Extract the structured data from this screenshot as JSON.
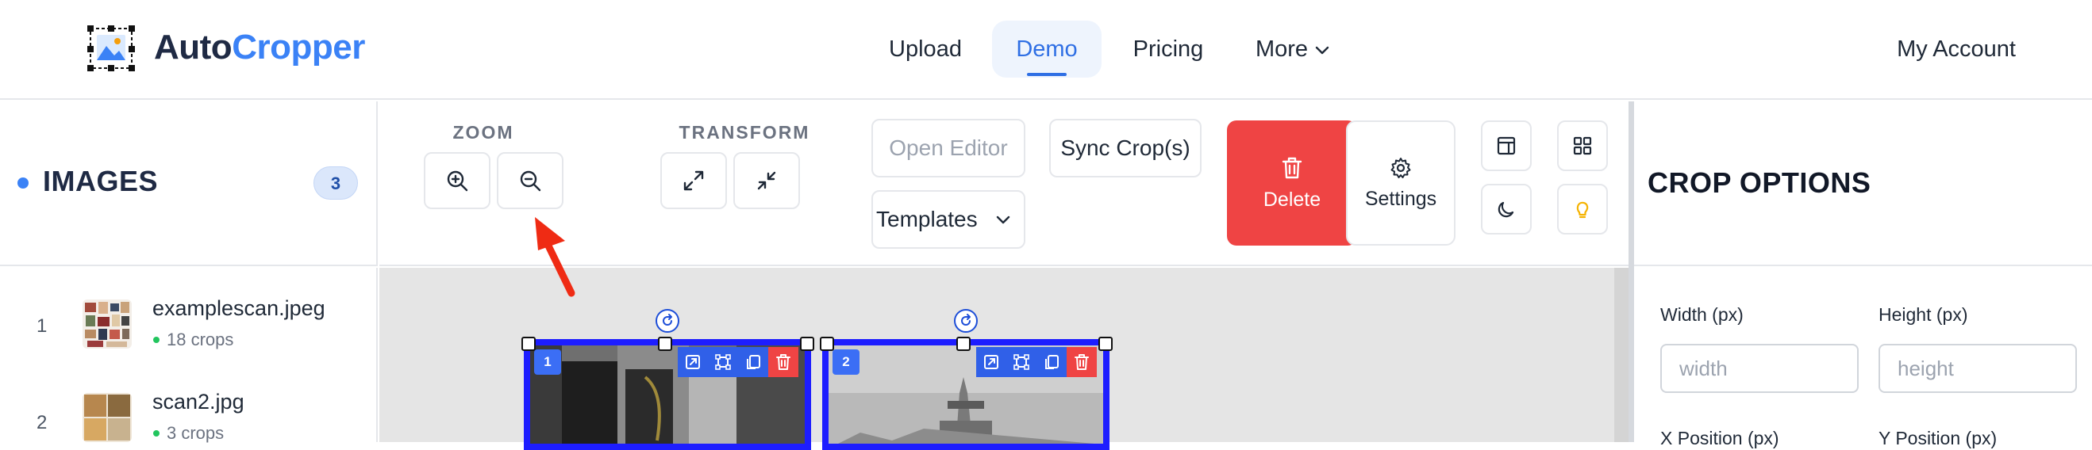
{
  "header": {
    "logo": {
      "part1": "Auto",
      "part2": "Cropper",
      "icon": "image-crop-icon"
    },
    "nav": [
      {
        "label": "Upload"
      },
      {
        "label": "Demo",
        "active": true
      },
      {
        "label": "Pricing"
      },
      {
        "label": "More",
        "icon": "chevron-down-icon"
      }
    ],
    "account_label": "My Account"
  },
  "sidebar": {
    "title": "IMAGES",
    "count": "3",
    "items": [
      {
        "index": "1",
        "name": "examplescan.jpeg",
        "crops": "18 crops"
      },
      {
        "index": "2",
        "name": "scan2.jpg",
        "crops": "3 crops"
      }
    ]
  },
  "toolbar": {
    "zoom_label": "ZOOM",
    "transform_label": "TRANSFORM",
    "open_editor_label": "Open Editor",
    "sync_crops_label": "Sync Crop(s)",
    "templates_label": "Templates",
    "delete_label": "Delete",
    "settings_label": "Settings"
  },
  "crop_options": {
    "title": "CROP OPTIONS",
    "fields": [
      {
        "label": "Width (px)",
        "placeholder": "width"
      },
      {
        "label": "Height (px)",
        "placeholder": "height"
      },
      {
        "label": "X Position (px)"
      },
      {
        "label": "Y Position (px)"
      }
    ]
  },
  "canvas": {
    "crops": [
      {
        "number": "1"
      },
      {
        "number": "2"
      }
    ]
  },
  "colors": {
    "accent": "#3b82f6",
    "delete": "#ef4444",
    "crop_border": "#1d1dff",
    "annotation_arrow": "#ef2b14"
  }
}
